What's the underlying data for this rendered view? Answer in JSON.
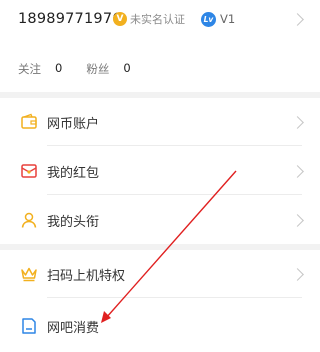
{
  "profile": {
    "phone": "18989771976",
    "real_name_badge": "未实名认证",
    "vip_level": "V1",
    "stats": [
      {
        "label": "关注",
        "value": "0"
      },
      {
        "label": "粉丝",
        "value": "0"
      }
    ]
  },
  "menu": {
    "items": [
      {
        "label": "网币账户",
        "icon": "wallet-icon"
      },
      {
        "label": "我的红包",
        "icon": "red-envelope-icon"
      },
      {
        "label": "我的头衔",
        "icon": "user-title-icon"
      },
      {
        "label": "扫码上机特权",
        "icon": "crown-icon"
      },
      {
        "label": "网吧消费",
        "icon": "receipt-icon"
      }
    ]
  },
  "colors": {
    "accent_orange": "#f2b01e",
    "level_blue": "#2e86e6",
    "red_envelope": "#e8413c",
    "annotation_arrow": "#e02020"
  }
}
